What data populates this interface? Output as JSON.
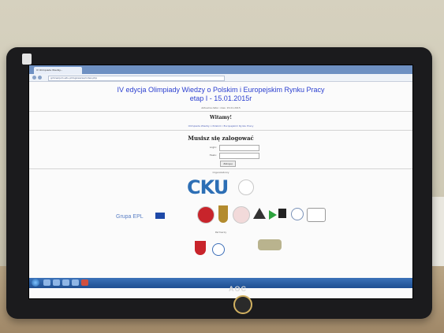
{
  "browser": {
    "tab_label": "IV Olimpiada Wiedzy...",
    "url": "gimnazjum.edu.pl/logowanie/index.php"
  },
  "page": {
    "title_line1": "IV edycja Olimpiady Wiedzy o Polskim i Europejskim Rynku Pracy",
    "title_line2": "etap I - 15.01.2015r",
    "subtitle": "Aktualna data i czas: 15.01.2015",
    "greeting": "Witamy!",
    "info_text": "Olimpiada Wiedzy o Polskim i Europejskim Rynku Pracy",
    "login_heading": "Musisz się zalogować",
    "login_label": "Login:",
    "password_label": "Hasło:",
    "login_button": "Zaloguj",
    "organizers_label": "Organizatorzy",
    "partners_label": "Partnerzy",
    "logos": {
      "cku": "CKU",
      "epl": "Grupa EPL"
    }
  },
  "monitor": {
    "brand": "AOC"
  },
  "colors": {
    "title": "#2b3fd0",
    "taskbar": "#1e4f92",
    "cku": "#2d6fb5"
  }
}
